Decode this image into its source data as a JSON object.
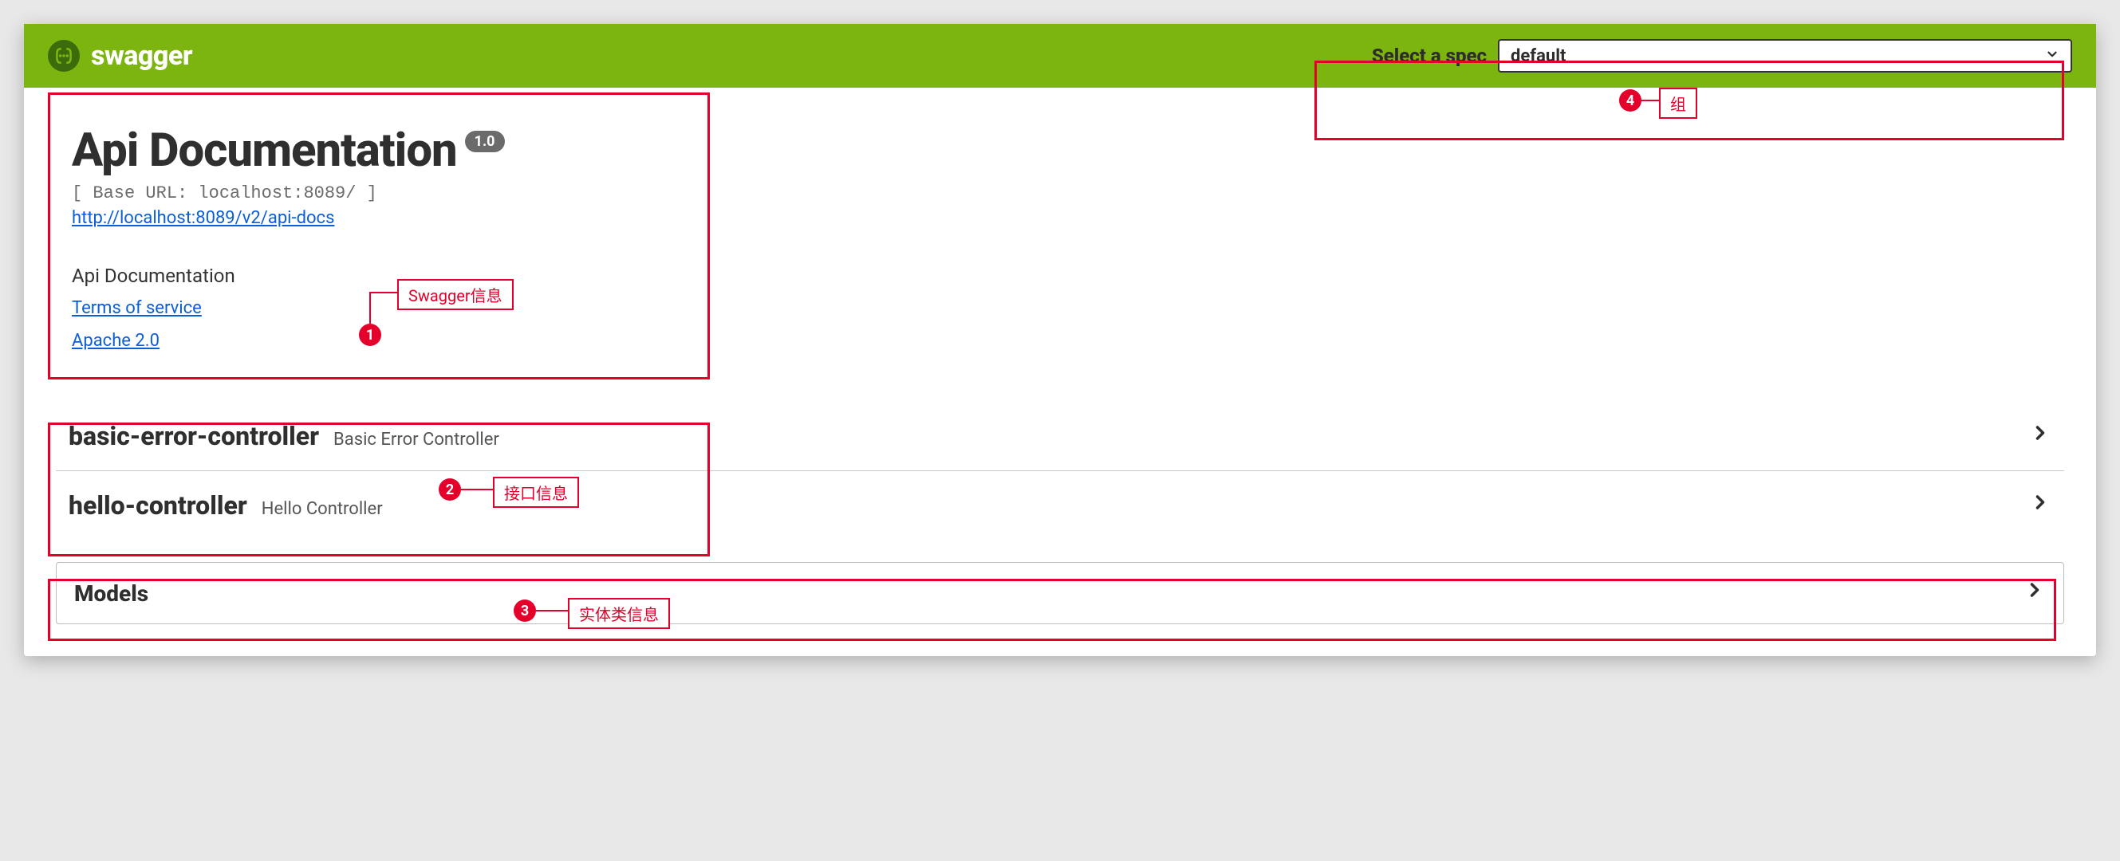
{
  "topbar": {
    "brand": "swagger",
    "spec_label": "Select a spec",
    "spec_selected": "default"
  },
  "info": {
    "title": "Api Documentation",
    "version": "1.0",
    "base_url_line": "[ Base URL: localhost:8089/ ]",
    "docs_url": "http://localhost:8089/v2/api-docs",
    "description": "Api Documentation",
    "tos_label": "Terms of service",
    "license_label": "Apache 2.0"
  },
  "controllers": [
    {
      "name": "basic-error-controller",
      "desc": "Basic Error Controller"
    },
    {
      "name": "hello-controller",
      "desc": "Hello Controller"
    }
  ],
  "models": {
    "title": "Models"
  },
  "annotations": {
    "a1": {
      "num": "1",
      "label": "Swagger信息"
    },
    "a2": {
      "num": "2",
      "label": "接口信息"
    },
    "a3": {
      "num": "3",
      "label": "实体类信息"
    },
    "a4": {
      "num": "4",
      "label": "组"
    }
  }
}
